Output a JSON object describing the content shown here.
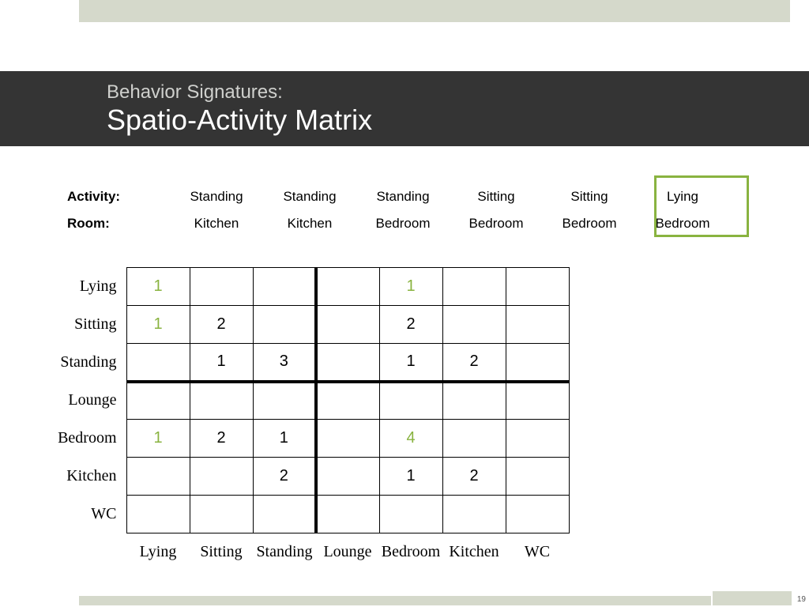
{
  "title": {
    "sub": "Behavior Signatures:",
    "main": "Spatio-Activity Matrix"
  },
  "seq": {
    "activity_label": "Activity:",
    "room_label": "Room:",
    "cols": [
      {
        "activity": "Standing",
        "room": "Kitchen"
      },
      {
        "activity": "Standing",
        "room": "Kitchen"
      },
      {
        "activity": "Standing",
        "room": "Bedroom"
      },
      {
        "activity": "Sitting",
        "room": "Bedroom"
      },
      {
        "activity": "Sitting",
        "room": "Bedroom"
      },
      {
        "activity": "Lying",
        "room": "Bedroom"
      }
    ]
  },
  "matrix": {
    "row_labels": [
      "Lying",
      "Sitting",
      "Standing",
      "Lounge",
      "Bedroom",
      "Kitchen",
      "WC"
    ],
    "col_labels": [
      "Lying",
      "Sitting",
      "Standing",
      "Lounge",
      "Bedroom",
      "Kitchen",
      "WC"
    ],
    "cells": [
      [
        {
          "v": "1",
          "c": "green"
        },
        {
          "v": ""
        },
        {
          "v": ""
        },
        {
          "v": ""
        },
        {
          "v": "1",
          "c": "green"
        },
        {
          "v": ""
        },
        {
          "v": ""
        }
      ],
      [
        {
          "v": "1",
          "c": "green"
        },
        {
          "v": "2"
        },
        {
          "v": ""
        },
        {
          "v": ""
        },
        {
          "v": "2"
        },
        {
          "v": ""
        },
        {
          "v": ""
        }
      ],
      [
        {
          "v": ""
        },
        {
          "v": "1"
        },
        {
          "v": "3"
        },
        {
          "v": ""
        },
        {
          "v": "1"
        },
        {
          "v": "2"
        },
        {
          "v": ""
        }
      ],
      [
        {
          "v": ""
        },
        {
          "v": ""
        },
        {
          "v": ""
        },
        {
          "v": ""
        },
        {
          "v": ""
        },
        {
          "v": ""
        },
        {
          "v": ""
        }
      ],
      [
        {
          "v": "1",
          "c": "green"
        },
        {
          "v": "2"
        },
        {
          "v": "1"
        },
        {
          "v": ""
        },
        {
          "v": "4",
          "c": "green"
        },
        {
          "v": ""
        },
        {
          "v": ""
        }
      ],
      [
        {
          "v": ""
        },
        {
          "v": ""
        },
        {
          "v": "2"
        },
        {
          "v": ""
        },
        {
          "v": "1"
        },
        {
          "v": "2"
        },
        {
          "v": ""
        }
      ],
      [
        {
          "v": ""
        },
        {
          "v": ""
        },
        {
          "v": ""
        },
        {
          "v": ""
        },
        {
          "v": ""
        },
        {
          "v": ""
        },
        {
          "v": ""
        }
      ]
    ]
  },
  "page_number": "19"
}
